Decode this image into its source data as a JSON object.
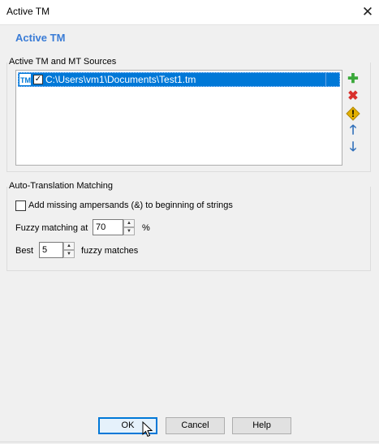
{
  "window": {
    "title": "Active TM",
    "close_glyph": "✕"
  },
  "header": {
    "title": "Active TM"
  },
  "sources": {
    "group_label": "Active TM and MT Sources",
    "items": [
      {
        "icon_text": "TM",
        "checked": true,
        "check_glyph": "✓",
        "path": "C:\\Users\\vm1\\Documents\\Test1.tm"
      }
    ],
    "buttons": {
      "add_glyph": "✚",
      "add_color": "#3aa83a",
      "remove_glyph": "✖",
      "remove_color": "#d9302c",
      "warn_glyph": "!",
      "warn_color": "#e3b100",
      "up_glyph": "🡑",
      "up_color": "#2f6fba",
      "down_glyph": "🡓",
      "down_color": "#2f6fba"
    }
  },
  "auto_translation": {
    "group_label": "Auto-Translation Matching",
    "ampersand_label": "Add missing ampersands (&) to beginning of strings",
    "ampersand_checked": false,
    "fuzzy_prefix": "Fuzzy matching at",
    "fuzzy_value": "70",
    "fuzzy_suffix": "%",
    "best_prefix": "Best",
    "best_value": "5",
    "best_suffix": "fuzzy matches",
    "spin_up_glyph": "▲",
    "spin_down_glyph": "▼"
  },
  "footer": {
    "ok_label": "OK",
    "cancel_label": "Cancel",
    "help_label": "Help"
  },
  "colors": {
    "accent": "#3a7cd6",
    "selection": "#0078d7"
  }
}
